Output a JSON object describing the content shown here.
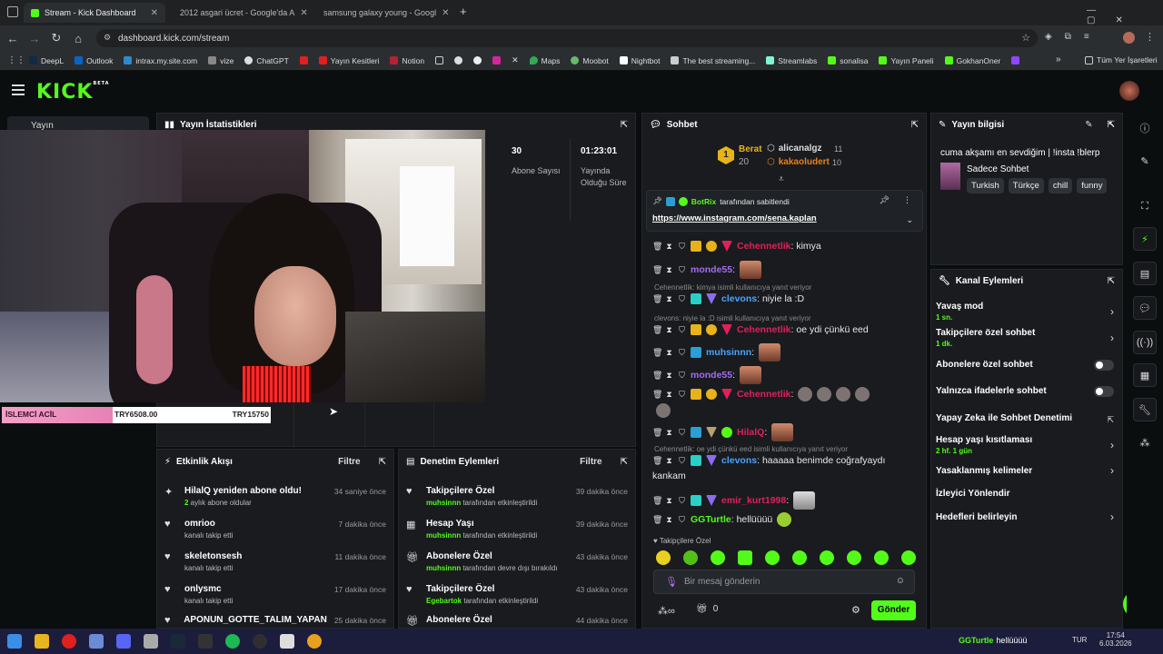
{
  "browser": {
    "tabs": [
      {
        "title": "Stream - Kick Dashboard",
        "color": "#53fc18"
      },
      {
        "title": "2012 asgari ücret - Google'da A",
        "color": "#4285f4"
      },
      {
        "title": "samsung galaxy young - Googl",
        "color": "#4285f4"
      }
    ],
    "url": "dashboard.kick.com/stream",
    "bookmarks": [
      "DeepL",
      "Outlook",
      "intrax.my.site.com",
      "vize",
      "ChatGPT",
      "Yayın Kesitleri",
      "Notion",
      "Maps",
      "Moobot",
      "Nightbot",
      "The best streaming...",
      "Streamlabs",
      "sonalisa",
      "Yayın Paneli",
      "GokhanOner"
    ],
    "all_bookmarks": "Tüm Yer İşaretleri"
  },
  "kick": {
    "logo": "KICK",
    "logo_sup": "BETA"
  },
  "leftnav": {
    "label": "Yayın"
  },
  "stats": {
    "title": "Yayın İstatistikleri",
    "subs": {
      "value": "30",
      "label": "Abone Sayısı"
    },
    "uptime": {
      "value": "01:23:01",
      "label": "Yayında Olduğu Süre"
    }
  },
  "overlay": {
    "left": "İSLEMCİ ACİL",
    "mid": "TRY6508.00",
    "right": "TRY15750"
  },
  "activity": {
    "title": "Etkinlik Akışı",
    "filter": "Filtre",
    "items": [
      {
        "title": "HilalQ yeniden abone oldu!",
        "sub_hl": "2",
        "sub": " aylık abone oldular",
        "time": "34 saniye önce"
      },
      {
        "title": "omrioo",
        "sub": "kanalı takip etti",
        "time": "7 dakika önce"
      },
      {
        "title": "skeletonsesh",
        "sub": "kanalı takip etti",
        "time": "11 dakika önce"
      },
      {
        "title": "onlysmc",
        "sub": "kanalı takip etti",
        "time": "17 dakika önce"
      },
      {
        "title": "APONUN_GOTTE_TALIM_YAPAN",
        "sub": "",
        "time": "25 dakika önce"
      }
    ]
  },
  "moderation": {
    "title": "Denetim Eylemleri",
    "filter": "Filtre",
    "items": [
      {
        "title": "Takipçilere Özel",
        "user": "muhsinnn",
        "sub": " tarafından etkinleştirildi",
        "time": "39 dakika önce"
      },
      {
        "title": "Hesap Yaşı",
        "user": "muhsinnn",
        "sub": " tarafından etkinleştirildi",
        "time": "39 dakika önce"
      },
      {
        "title": "Abonelere Özel",
        "user": "muhsinnn",
        "sub": " tarafından devre dışı bırakıldı",
        "time": "43 dakika önce"
      },
      {
        "title": "Takipçilere Özel",
        "user": "Egebartok",
        "sub": " tarafından etkinleştirildi",
        "time": "43 dakika önce"
      },
      {
        "title": "Abonelere Özel",
        "user": "",
        "sub": "",
        "time": "44 dakika önce"
      }
    ]
  },
  "chat": {
    "title": "Sohbet",
    "top": [
      {
        "rank": "1",
        "name": "Berat",
        "count": "20"
      },
      {
        "name": "alicanalgz",
        "count": "11"
      },
      {
        "name": "kakaoludert",
        "count": "10"
      }
    ],
    "pinned_by": "BotRix",
    "pinned_suffix": " tarafından sabitlendi",
    "pinned_link": "https://www.instagram.com/sena.kaplan",
    "messages": [
      {
        "user": "Cehennetlik",
        "color": "#e0205a",
        "text": ": kimya"
      },
      {
        "user": "monde55",
        "color": "#a46cf0",
        "text": ":"
      },
      {
        "reply": "Cehennetlik: kimya isimli kullanıcıya yanıt veriyor"
      },
      {
        "user": "clevons",
        "color": "#4aa3ff",
        "text": ": niyie la :D"
      },
      {
        "reply": "clevons: niyie la :D isimli kullanıcıya yanıt veriyor"
      },
      {
        "user": "Cehennetlik",
        "color": "#e0205a",
        "text": ": oe ydi çünkü eed"
      },
      {
        "user": "muhsinnn",
        "color": "#4aa3ff",
        "text": ":"
      },
      {
        "user": "monde55",
        "color": "#a46cf0",
        "text": ":"
      },
      {
        "user": "Cehennetlik",
        "color": "#e0205a",
        "text": ":"
      },
      {
        "user": "HilalQ",
        "color": "#e0205a",
        "text": ":"
      },
      {
        "reply": "Cehennetlik: oe ydi çünkü eed isimli kullanıcıya yanıt veriyor"
      },
      {
        "user": "clevons",
        "color": "#4aa3ff",
        "text": ": haaaaa benimde coğrafyaydı"
      },
      {
        "text2": "kankam"
      },
      {
        "user": "emir_kurt1998",
        "color": "#e0205a",
        "text": ":"
      },
      {
        "user": "GGTurtle",
        "color": "#53fc18",
        "text": ": hellüüüü"
      }
    ],
    "followers_only": "Takipçilere Özel",
    "placeholder": "Bir mesaj gönderin",
    "points": "0",
    "send": "Gönder"
  },
  "stream_info": {
    "title": "Yayın bilgisi",
    "stream_title": "cuma akşamı en sevdiğim | !insta !blerp",
    "category": "Sadece Sohbet",
    "tags": [
      "Turkish",
      "Türkçe",
      "chill",
      "funny"
    ]
  },
  "channel_actions": {
    "title": "Kanal Eylemleri",
    "items": [
      {
        "label": "Yavaş mod",
        "sub": "1 sn.",
        "control": "chevron"
      },
      {
        "label": "Takipçilere özel sohbet",
        "sub": "1 dk.",
        "control": "chevron"
      },
      {
        "label": "Abonelere özel sohbet",
        "sub": "",
        "control": "toggle"
      },
      {
        "label": "Yalnızca ifadelerle sohbet",
        "sub": "",
        "control": "toggle"
      },
      {
        "label": "Yapay Zeka ile Sohbet Denetimi",
        "sub": "",
        "control": "link"
      },
      {
        "label": "Hesap yaşı kısıtlaması",
        "sub": "2 hf. 1 gün",
        "control": "chevron"
      },
      {
        "label": "Yasaklanmış kelimeler",
        "sub": "",
        "control": "chevron"
      },
      {
        "label": "İzleyici Yönlendir",
        "sub": "",
        "control": "none"
      },
      {
        "label": "Hedefleri belirleyin",
        "sub": "",
        "control": "chevron"
      }
    ]
  },
  "taskbar": {
    "time": "17:54",
    "date": "6.03.2026",
    "lang": "TUR",
    "notif_user": "GGTurtle",
    "notif_text": "hellüüüü"
  },
  "colors": {
    "accent": "#53fc18",
    "panel": "#191b1f",
    "bg": "#0b0e0f"
  }
}
